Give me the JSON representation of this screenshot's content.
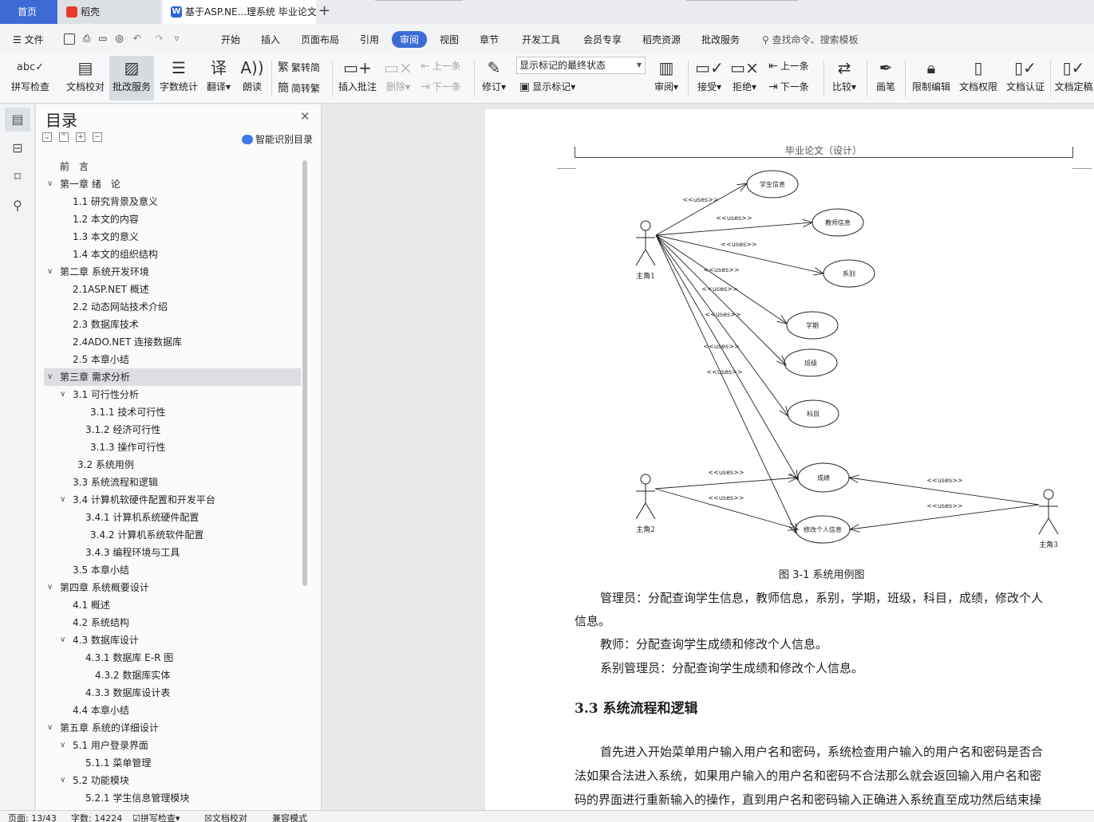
{
  "tabs": {
    "home": "首页",
    "daoke": "稻壳",
    "document": "基于ASP.NE...理系统 毕业论文",
    "add": "+"
  },
  "menu": {
    "file": "文件",
    "items": [
      "开始",
      "插入",
      "页面布局",
      "引用",
      "审阅",
      "视图",
      "章节",
      "开发工具",
      "会员专享",
      "稻壳资源",
      "批改服务"
    ],
    "active": "审阅",
    "search": "查找命令、搜索模板"
  },
  "ribbon": {
    "spell_check": "拼写检查",
    "doc_proof": "文档校对",
    "review_service": "批改服务",
    "word_count": "字数统计",
    "translate": "翻译",
    "read_aloud": "朗读",
    "trad_convert": "繁转简",
    "simp_convert": "简转繁",
    "insert_comment": "插入批注",
    "delete": "删除",
    "prev_comment": "上一条",
    "next_comment": "下一条",
    "revise": "修订",
    "markup_state": "显示标记的最终状态",
    "show_markup": "显示标记",
    "review_pane": "审阅",
    "accept": "接受",
    "reject": "拒绝",
    "prev_change": "上一条",
    "next_change": "下一条",
    "compare": "比较",
    "pen": "画笔",
    "restrict_edit": "限制编辑",
    "doc_permission": "文档权限",
    "doc_cert": "文档认证",
    "doc_finalize": "文档定稿"
  },
  "toc": {
    "title": "目录",
    "smart_toc": "智能识别目录",
    "items": [
      {
        "text": "前　言",
        "level": 0,
        "expand": false
      },
      {
        "text": "第一章  绪　论",
        "level": 0,
        "expand": true
      },
      {
        "text": "1.1 研究背景及意义",
        "level": 1,
        "expand": false
      },
      {
        "text": "1.2 本文的内容",
        "level": 1,
        "expand": false
      },
      {
        "text": "1.3 本文的意义",
        "level": 1,
        "expand": false
      },
      {
        "text": "1.4 本文的组织结构",
        "level": 1,
        "expand": false
      },
      {
        "text": "第二章  系统开发环境",
        "level": 0,
        "expand": true
      },
      {
        "text": "2.1ASP.NET 概述",
        "level": 1,
        "expand": false
      },
      {
        "text": "2.2 动态网站技术介绍",
        "level": 1,
        "expand": false
      },
      {
        "text": "2.3 数据库技术",
        "level": 1,
        "expand": false
      },
      {
        "text": "2.4ADO.NET 连接数据库",
        "level": 1,
        "expand": false
      },
      {
        "text": "2.5 本章小结",
        "level": 1,
        "expand": false
      },
      {
        "text": "第三章  需求分析",
        "level": 0,
        "expand": true,
        "selected": true
      },
      {
        "text": "3.1 可行性分析",
        "level": 1,
        "expand": true
      },
      {
        "text": "3.1.1 技术可行性",
        "level": 3,
        "expand": false
      },
      {
        "text": "3.1.2  经济可行性",
        "level": 2,
        "expand": false
      },
      {
        "text": "3.1.3 操作可行性",
        "level": 3,
        "expand": false
      },
      {
        "text": "3.2 系统用例",
        "level": 4,
        "expand": false
      },
      {
        "text": "3.3 系统流程和逻辑",
        "level": 1,
        "expand": false
      },
      {
        "text": "3.4 计算机软硬件配置和开发平台",
        "level": 1,
        "expand": true
      },
      {
        "text": "3.4.1 计算机系统硬件配置",
        "level": 2,
        "expand": false
      },
      {
        "text": "3.4.2 计算机系统软件配置",
        "level": 3,
        "expand": false
      },
      {
        "text": "3.4.3 编程环境与工具",
        "level": 2,
        "expand": false
      },
      {
        "text": "3.5 本章小结",
        "level": 1,
        "expand": false
      },
      {
        "text": "第四章  系统概要设计",
        "level": 0,
        "expand": true
      },
      {
        "text": "4.1 概述",
        "level": 1,
        "expand": false
      },
      {
        "text": "4.2 系统结构",
        "level": 1,
        "expand": false
      },
      {
        "text": "4.3 数据库设计",
        "level": 1,
        "expand": true
      },
      {
        "text": "4.3.1 数据库 E-R 图",
        "level": 2,
        "expand": false
      },
      {
        "text": "4.3.2 数据库实体",
        "level": 5,
        "expand": false
      },
      {
        "text": "4.3.3 数据库设计表",
        "level": 2,
        "expand": false
      },
      {
        "text": "4.4 本章小结",
        "level": 1,
        "expand": false
      },
      {
        "text": "第五章  系统的详细设计",
        "level": 0,
        "expand": true
      },
      {
        "text": "5.1 用户登录界面",
        "level": 1,
        "expand": true
      },
      {
        "text": "5.1.1 菜单管理",
        "level": 2,
        "expand": false
      },
      {
        "text": "5.2 功能模块",
        "level": 1,
        "expand": true
      },
      {
        "text": "5.2.1 学生信息管理模块",
        "level": 2,
        "expand": false
      }
    ]
  },
  "document": {
    "header": "毕业论文（设计）",
    "figure_caption": "图 3-1  系统用例图",
    "paragraphs": [
      "管理员：分配查询学生信息，教师信息，系别，学期，班级，科目，成绩，修改个人",
      "信息。",
      "教师：分配查询学生成绩和修改个人信息。",
      "系别管理员：分配查询学生成绩和修改个人信息。"
    ],
    "section_heading": "3.3 系统流程和逻辑",
    "body_lines": [
      "首先进入开始菜单用户输入用户名和密码，系统检查用户输入的用户名和密码是否合",
      "法如果合法进入系统，如果用户输入的用户名和密码不合法那么就会返回输入用户名和密",
      "码的界面进行重新输入的操作，直到用户名和密码输入正确进入系统直至成功然后结束操"
    ],
    "diagram": {
      "actors": [
        "主角1",
        "主角2",
        "主角3"
      ],
      "use_cases": [
        "学生信息",
        "教师信息",
        "系别",
        "学期",
        "班级",
        "科目",
        "成绩",
        "修改个人信息"
      ],
      "relation_label": "<<uses>>"
    }
  },
  "status": {
    "page": "页面: 13/43",
    "words": "字数: 14224",
    "spell": "拼写检查",
    "proof": "文档校对",
    "compat": "兼容模式"
  }
}
